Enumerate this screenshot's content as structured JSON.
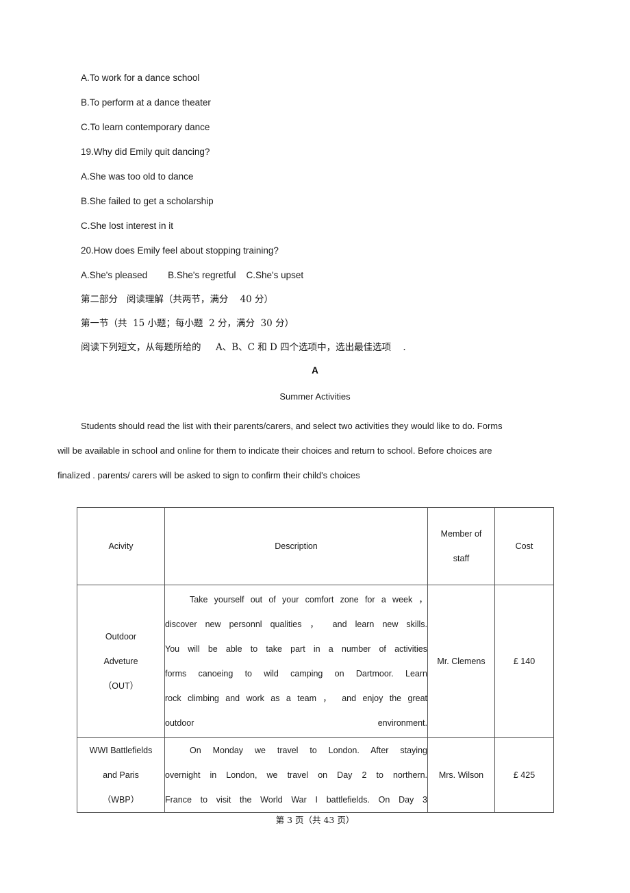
{
  "mcq": {
    "lines": [
      "A.To work for a dance school",
      "B.To perform at a dance theater",
      "C.To learn contemporary dance",
      "19.Why did Emily quit dancing?",
      "A.She was too old to dance",
      "B.She failed to get a scholarship",
      "C.She lost interest in it",
      "20.How does Emily feel about stopping training?",
      "A.She's pleased        B.She's regretful    C.She's upset"
    ]
  },
  "instructions": {
    "part_two": "第二部分   阅读理解（共两节，满分    40 分）",
    "section_one": "第一节（共  15 小题；每小题  2 分，满分  30 分）",
    "directions": "阅读下列短文，从每题所给的     A、B、C 和 D 四个选项中，选出最佳选项    ."
  },
  "passage": {
    "letter": "A",
    "title": "Summer Activities",
    "intro_lines": [
      "Students should read the list with their parents/carers, and select two activities they would like to do. Forms",
      "will be available in school and online for them to indicate their choices and return to school. Before choices are",
      "finalized . parents/ carers will be asked to sign to confirm their child's choices"
    ]
  },
  "table": {
    "headers": {
      "activity": "Acivity",
      "description": "Description",
      "staff_line1": "Member of",
      "staff_line2": "staff",
      "cost": "Cost"
    },
    "rows": [
      {
        "activity_lines": [
          "Outdoor",
          "Adveture",
          "（OUT）"
        ],
        "description_lines": [
          "Take yourself out of your comfort zone for a week  ，",
          "discover new personnl qualities   ，  and learn new skills.",
          "You will  be able to  take part  in a  number  of activities",
          "forms  canoeing  to wild  camping on  Dartmoor.  Learn",
          "rock climbing and work as a team  ，  and enjoy the great",
          "outdoor environment."
        ],
        "staff": "Mr. Clemens",
        "cost": "£ 140"
      },
      {
        "activity_lines": [
          "WWI Battlefields",
          "and Paris",
          "（WBP）"
        ],
        "description_lines": [
          "On  Monday  we  travel  to London. After  staying",
          "overnight  in London, we  travel  on  Day 2 to  northern.",
          "France to  visit  the  World  War  I battlefields.  On Day 3"
        ],
        "staff": "Mrs. Wilson",
        "cost": "£ 425"
      }
    ]
  },
  "footer": {
    "page_label": "第 3 页（共 43 页）"
  }
}
